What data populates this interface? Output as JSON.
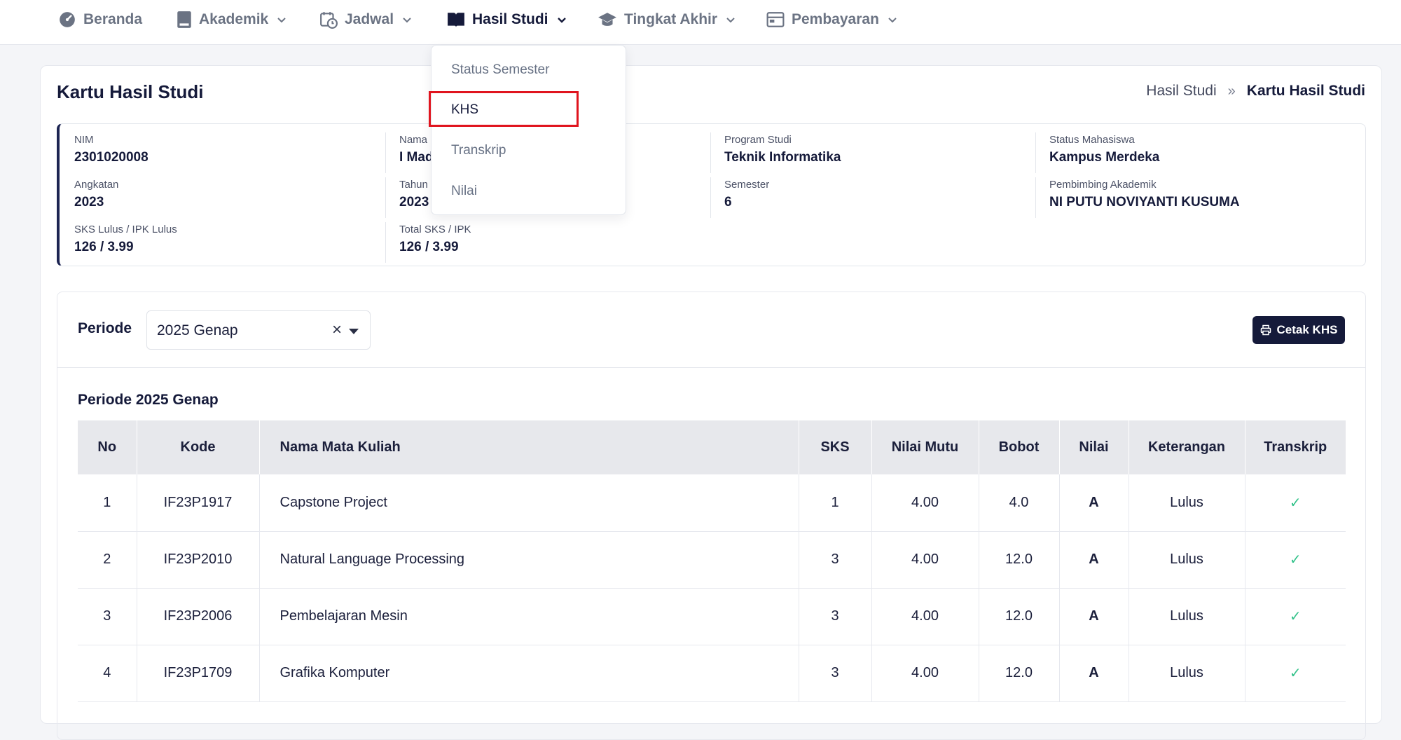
{
  "nav": {
    "items": [
      {
        "label": "Beranda",
        "icon": "dashboard-icon"
      },
      {
        "label": "Akademik",
        "icon": "book-icon"
      },
      {
        "label": "Jadwal",
        "icon": "calendar-clock-icon"
      },
      {
        "label": "Hasil Studi",
        "icon": "open-book-icon",
        "active": true
      },
      {
        "label": "Tingkat Akhir",
        "icon": "graduation-cap-icon"
      },
      {
        "label": "Pembayaran",
        "icon": "card-icon"
      }
    ]
  },
  "dropdown": {
    "items": [
      "Status Semester",
      "KHS",
      "Transkrip",
      "Nilai"
    ],
    "selected": "KHS"
  },
  "page": {
    "title": "Kartu Hasil Studi",
    "breadcrumb": {
      "parent": "Hasil Studi",
      "separator": "»",
      "current": "Kartu Hasil Studi"
    }
  },
  "info": {
    "nim": {
      "label": "NIM",
      "value": "2301020008"
    },
    "nama": {
      "label": "Nama",
      "value": "I Mad"
    },
    "program_studi": {
      "label": "Program Studi",
      "value": "Teknik Informatika"
    },
    "status_mahasiswa": {
      "label": "Status Mahasiswa",
      "value": "Kampus Merdeka"
    },
    "angkatan": {
      "label": "Angkatan",
      "value": "2023"
    },
    "tahun": {
      "label": "Tahun",
      "value": "2023"
    },
    "semester": {
      "label": "Semester",
      "value": "6"
    },
    "pembimbing": {
      "label": "Pembimbing Akademik",
      "value": "NI PUTU NOVIYANTI KUSUMA"
    },
    "sks_lulus": {
      "label": "SKS Lulus / IPK Lulus",
      "value": "126 / 3.99"
    },
    "total_sks": {
      "label": "Total SKS / IPK",
      "value": "126 / 3.99"
    }
  },
  "filter": {
    "label": "Periode",
    "selected": "2025 Genap",
    "clear_symbol": "×",
    "print_label": "Cetak KHS"
  },
  "period_heading": "Periode 2025 Genap",
  "table": {
    "headers": [
      "No",
      "Kode",
      "Nama Mata Kuliah",
      "SKS",
      "Nilai Mutu",
      "Bobot",
      "Nilai",
      "Keterangan",
      "Transkrip"
    ],
    "rows": [
      {
        "no": "1",
        "kode": "IF23P1917",
        "nama": "Capstone Project",
        "sks": "1",
        "mutu": "4.00",
        "bobot": "4.0",
        "nilai": "A",
        "ket": "Lulus",
        "transkrip": "✓"
      },
      {
        "no": "2",
        "kode": "IF23P2010",
        "nama": "Natural Language Processing",
        "sks": "3",
        "mutu": "4.00",
        "bobot": "12.0",
        "nilai": "A",
        "ket": "Lulus",
        "transkrip": "✓"
      },
      {
        "no": "3",
        "kode": "IF23P2006",
        "nama": "Pembelajaran Mesin",
        "sks": "3",
        "mutu": "4.00",
        "bobot": "12.0",
        "nilai": "A",
        "ket": "Lulus",
        "transkrip": "✓"
      },
      {
        "no": "4",
        "kode": "IF23P1709",
        "nama": "Grafika Komputer",
        "sks": "3",
        "mutu": "4.00",
        "bobot": "12.0",
        "nilai": "A",
        "ket": "Lulus",
        "transkrip": "✓"
      }
    ]
  },
  "colors": {
    "primary": "#151a3a",
    "highlight": "#e0141e",
    "check": "#33c28a",
    "header_bg": "#e7e8ec"
  }
}
